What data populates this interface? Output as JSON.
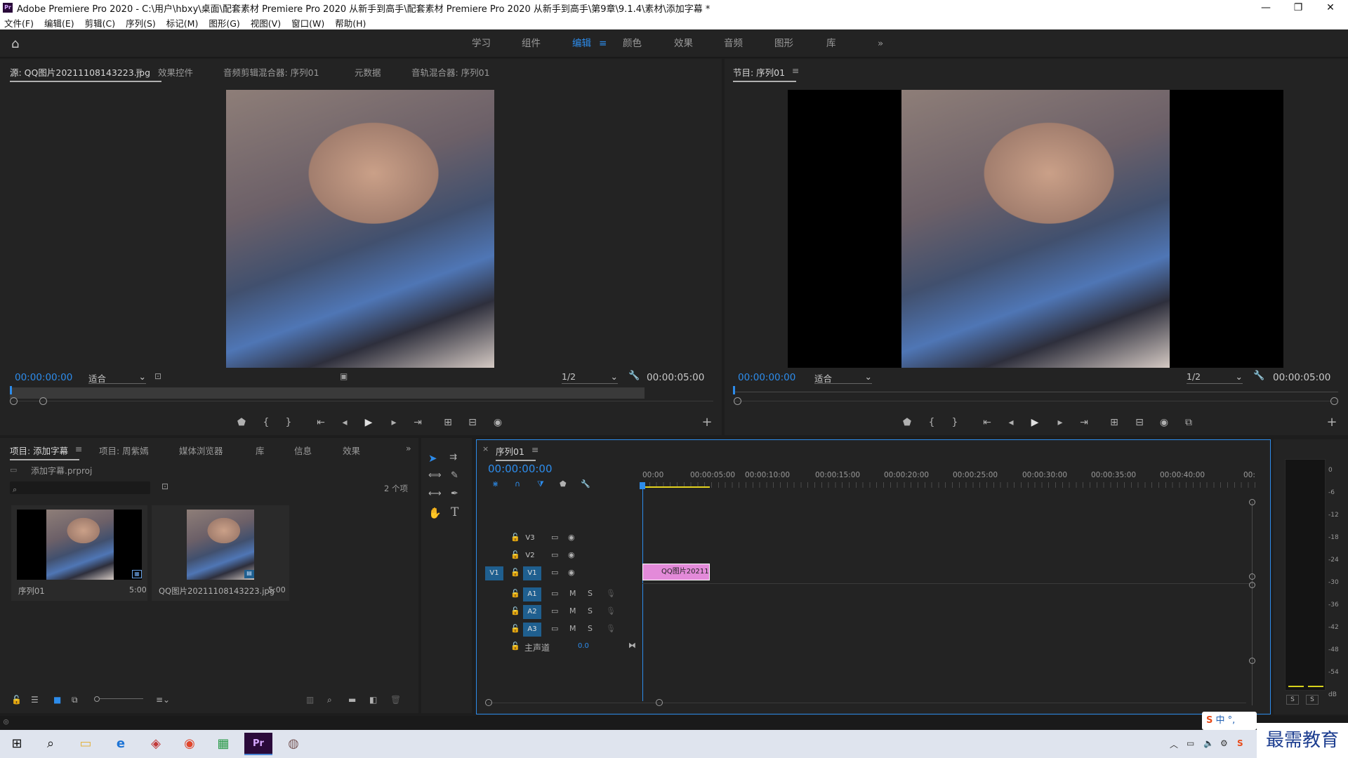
{
  "titlebar": {
    "logo": "Pr",
    "title": "Adobe Premiere Pro 2020 - C:\\用户\\hbxy\\桌面\\配套素材 Premiere Pro 2020 从新手到高手\\配套素材 Premiere Pro 2020 从新手到高手\\第9章\\9.1.4\\素材\\添加字幕 *",
    "minimize": "—",
    "maximize": "❐",
    "close": "✕"
  },
  "menu": [
    "文件(F)",
    "编辑(E)",
    "剪辑(C)",
    "序列(S)",
    "标记(M)",
    "图形(G)",
    "视图(V)",
    "窗口(W)",
    "帮助(H)"
  ],
  "workspaces": {
    "items": [
      "学习",
      "组件",
      "编辑",
      "颜色",
      "效果",
      "音频",
      "图形",
      "库"
    ],
    "active": "编辑",
    "more": "»"
  },
  "source_panel": {
    "tabs": [
      "源: QQ图片20211108143223.jpg",
      "效果控件",
      "音频剪辑混合器: 序列01",
      "元数据",
      "音轨混合器: 序列01"
    ],
    "timecode_in": "00:00:00:00",
    "fit": "适合",
    "resolution": "1/2",
    "duration": "00:00:05:00"
  },
  "program_panel": {
    "tab": "节目: 序列01",
    "timecode_in": "00:00:00:00",
    "fit": "适合",
    "resolution": "1/2",
    "duration": "00:00:05:00"
  },
  "project_panel": {
    "tabs": [
      "项目: 添加字幕",
      "项目: 周紫嫣",
      "媒体浏览器",
      "库",
      "信息",
      "效果"
    ],
    "file": "添加字幕.prproj",
    "count": "2 个项",
    "items": [
      {
        "name": "序列01",
        "duration": "5:00"
      },
      {
        "name": "QQ图片20211108143223.jpg",
        "duration": "5:00"
      }
    ]
  },
  "timeline": {
    "tab": "序列01",
    "timecode": "00:00:00:00",
    "ruler": [
      "00:00",
      "00:00:05:00",
      "00:00:10:00",
      "00:00:15:00",
      "00:00:20:00",
      "00:00:25:00",
      "00:00:30:00",
      "00:00:35:00",
      "00:00:40:00",
      "00:"
    ],
    "video_tracks": [
      "V3",
      "V2",
      "V1"
    ],
    "audio_tracks": [
      "A1",
      "A2",
      "A3"
    ],
    "master": "主声道",
    "master_value": "0.0",
    "clip": "QQ图片20211",
    "mute": "M",
    "solo": "S"
  },
  "meter": {
    "scale": [
      "0",
      "-6",
      "-12",
      "-18",
      "-24",
      "-30",
      "-36",
      "-42",
      "-48",
      "-54",
      "dB"
    ],
    "solo": [
      "S",
      "S"
    ]
  },
  "ime": {
    "label": "中",
    "extra": "°,"
  },
  "watermark": "最需教育",
  "colors": {
    "accent": "#2d8ceb",
    "clip": "#e38ad9",
    "panel": "#232323"
  }
}
